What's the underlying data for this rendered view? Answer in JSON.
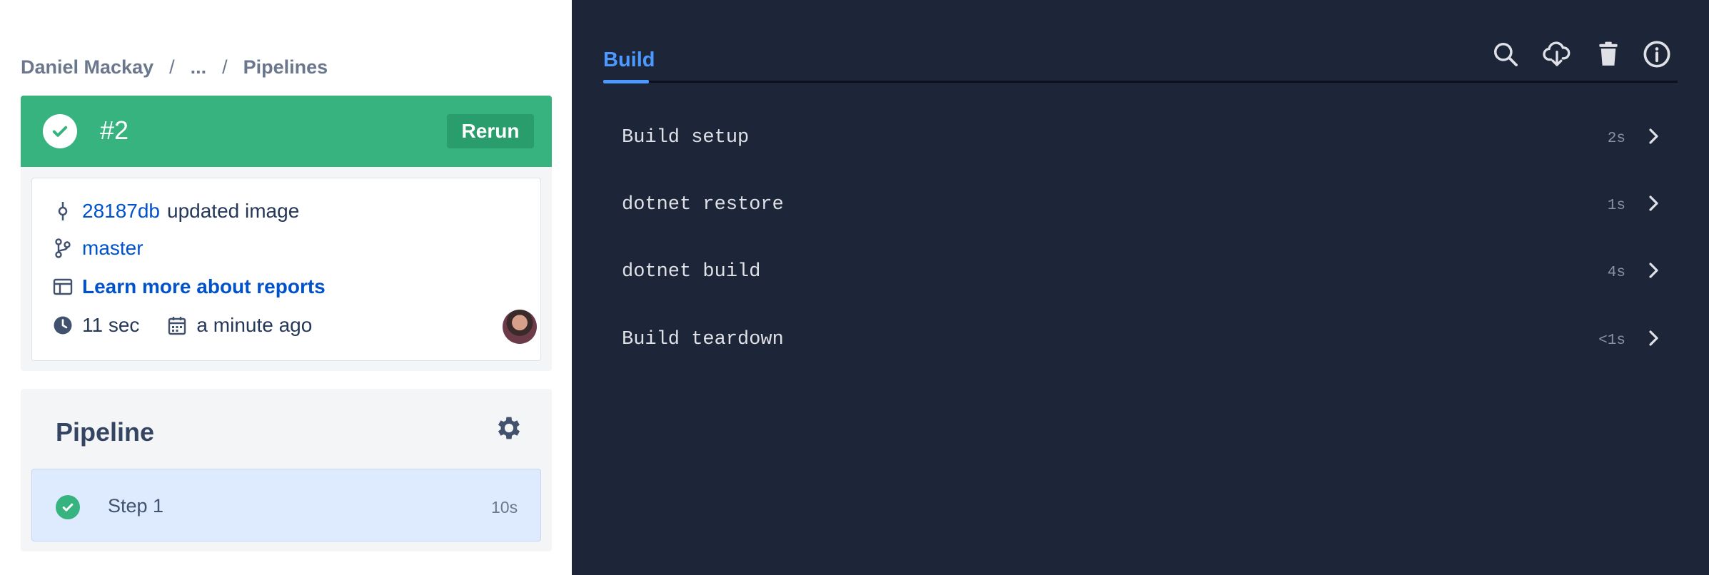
{
  "breadcrumb": {
    "owner": "Daniel Mackay",
    "ellipsis": "...",
    "current": "Pipelines",
    "separator": "/"
  },
  "run": {
    "number": "#2",
    "status": "successful",
    "rerun_label": "Rerun",
    "commit_hash": "28187db",
    "commit_message": "updated image",
    "branch": "master",
    "reports_link": "Learn more about reports",
    "duration": "11 sec",
    "started": "a minute ago"
  },
  "pipeline": {
    "title": "Pipeline",
    "steps": [
      {
        "name": "Step 1",
        "duration": "10s",
        "status": "successful"
      }
    ]
  },
  "log_panel": {
    "active_tab": "Build",
    "toolbar_icons": [
      "search-icon",
      "download-icon",
      "trash-icon",
      "info-icon"
    ],
    "sections": [
      {
        "name": "Build setup",
        "duration": "2s"
      },
      {
        "name": "dotnet restore",
        "duration": "1s"
      },
      {
        "name": "dotnet build",
        "duration": "4s"
      },
      {
        "name": "Build teardown",
        "duration": "<1s"
      }
    ]
  },
  "colors": {
    "success": "#36b37e",
    "link": "#0052cc",
    "log_background": "#1d2539",
    "tab_accent": "#4c9aff"
  }
}
